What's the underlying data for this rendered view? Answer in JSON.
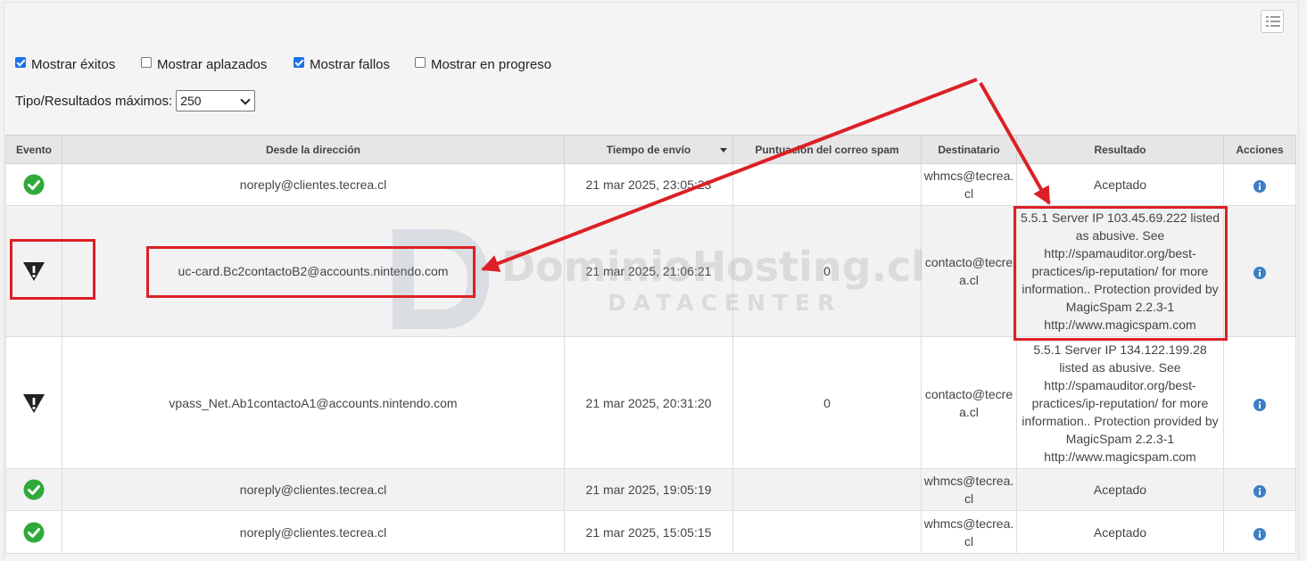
{
  "filters": [
    {
      "label": "Mostrar éxitos",
      "checked": true
    },
    {
      "label": "Mostrar aplazados",
      "checked": false
    },
    {
      "label": "Mostrar fallos",
      "checked": true
    },
    {
      "label": "Mostrar en progreso",
      "checked": false
    }
  ],
  "max_results": {
    "label": "Tipo/Resultados máximos:",
    "value": "250"
  },
  "table": {
    "headers": {
      "evento": "Evento",
      "desde": "Desde la dirección",
      "tiempo": "Tiempo de envío",
      "puntuacion": "Puntuación del correo spam",
      "destinatario": "Destinatario",
      "resultado": "Resultado",
      "acciones": "Acciones"
    },
    "rows": [
      {
        "event": "success",
        "from": "noreply@clientes.tecrea.cl",
        "time": "21 mar 2025, 23:05:23",
        "score": "",
        "to": "whmcs@tecrea.cl",
        "result": "Aceptado"
      },
      {
        "event": "failure",
        "from": "uc-card.Bc2contactoB2@accounts.nintendo.com",
        "time": "21 mar 2025, 21:06:21",
        "score": "0",
        "to": "contacto@tecrea.cl",
        "result": "5.5.1 Server IP 103.45.69.222 listed as abusive. See http://spamauditor.org/best-practices/ip-reputation/ for more information.. Protection provided by MagicSpam 2.2.3-1 http://www.magicspam.com"
      },
      {
        "event": "failure",
        "from": "vpass_Net.Ab1contactoA1@accounts.nintendo.com",
        "time": "21 mar 2025, 20:31:20",
        "score": "0",
        "to": "contacto@tecrea.cl",
        "result": "5.5.1 Server IP 134.122.199.28 listed as abusive. See http://spamauditor.org/best-practices/ip-reputation/ for more information.. Protection provided by MagicSpam 2.2.3-1 http://www.magicspam.com"
      },
      {
        "event": "success",
        "from": "noreply@clientes.tecrea.cl",
        "time": "21 mar 2025, 19:05:19",
        "score": "",
        "to": "whmcs@tecrea.cl",
        "result": "Aceptado"
      },
      {
        "event": "success",
        "from": "noreply@clientes.tecrea.cl",
        "time": "21 mar 2025, 15:05:15",
        "score": "",
        "to": "whmcs@tecrea.cl",
        "result": "Aceptado"
      }
    ]
  },
  "watermark": {
    "brand": "DominioHosting.cl",
    "sub": "DATACENTER"
  },
  "colors": {
    "success": "#2faa3a",
    "failure": "#222222",
    "info": "#3d7fc4",
    "annotation": "#dc2026"
  }
}
